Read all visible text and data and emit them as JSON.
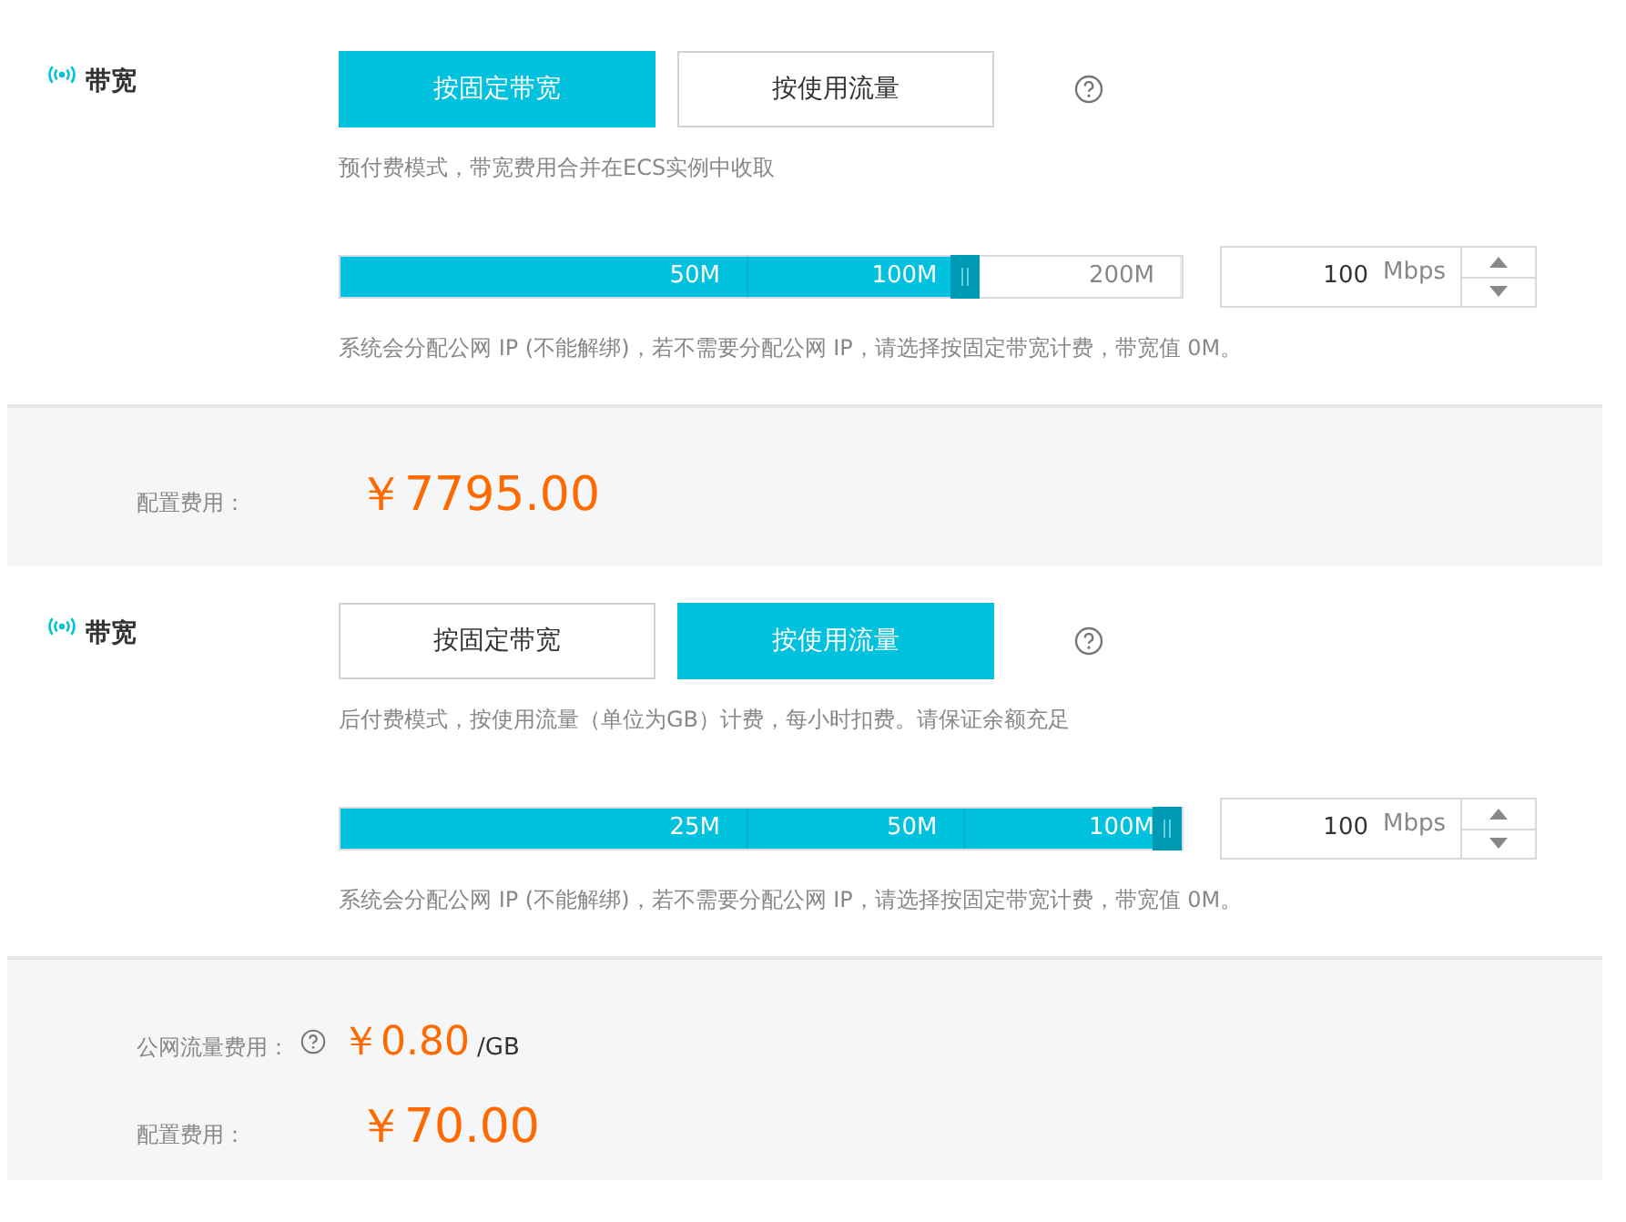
{
  "sections": [
    {
      "label": "带宽",
      "modes": [
        {
          "label": "按固定带宽",
          "selected": true
        },
        {
          "label": "按使用流量",
          "selected": false
        }
      ],
      "mode_note": "预付费模式，带宽费用合并在ECS实例中收取",
      "slider": {
        "level": 0.75,
        "ticks": [
          "50M",
          "100M",
          "200M"
        ]
      },
      "spinner": {
        "value": "100",
        "unit": "Mbps"
      },
      "note": "系统会分配公网 IP (不能解绑)，若不需要分配公网 IP，请选择按固定带宽计费，带宽值 0M。",
      "fees": [
        {
          "kind": "total",
          "label": "配置费用：",
          "help": false,
          "price": "￥7795.00"
        }
      ]
    },
    {
      "label": "带宽",
      "modes": [
        {
          "label": "按固定带宽",
          "selected": false
        },
        {
          "label": "按使用流量",
          "selected": true
        }
      ],
      "mode_note": "后付费模式，按使用流量（单位为GB）计费，每小时扣费。请保证余额充足",
      "slider": {
        "level": 1,
        "ticks": [
          "25M",
          "50M",
          "100M"
        ]
      },
      "spinner": {
        "value": "100",
        "unit": "Mbps"
      },
      "note": "系统会分配公网 IP (不能解绑)，若不需要分配公网 IP，请选择按固定带宽计费，带宽值 0M。",
      "fees": [
        {
          "kind": "rate",
          "label": "公网流量费用：",
          "help": true,
          "price": "￥0.80",
          "unit": "/GB"
        },
        {
          "kind": "total",
          "label": "配置费用：",
          "help": false,
          "price": "￥70.00"
        }
      ]
    }
  ]
}
